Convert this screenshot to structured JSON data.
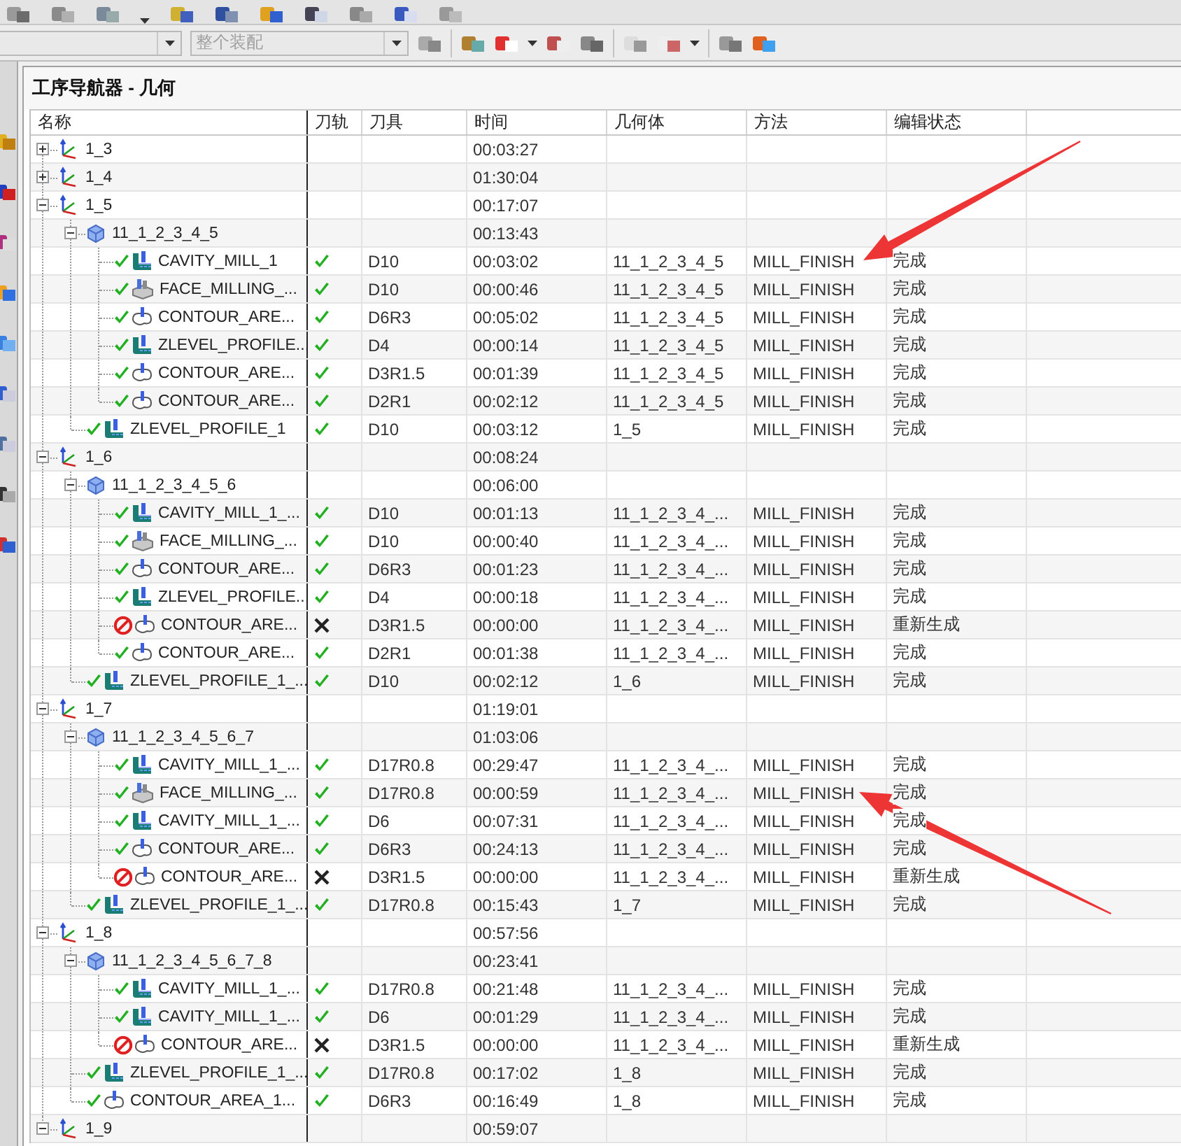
{
  "type_filter": {
    "value": "整个装配",
    "disabled": true
  },
  "navigator": {
    "title": "工序导航器 - 几何",
    "columns": [
      "名称",
      "刀轨",
      "刀具",
      "时间",
      "几何体",
      "方法",
      "编辑状态"
    ],
    "rows": [
      {
        "kind": "mcs",
        "name": "1_3",
        "expanded": false,
        "time": "00:03:27"
      },
      {
        "kind": "mcs",
        "name": "1_4",
        "expanded": false,
        "time": "01:30:04"
      },
      {
        "kind": "mcs",
        "name": "1_5",
        "expanded": true,
        "time": "00:17:07",
        "children": [
          {
            "kind": "workpiece",
            "name": "11_1_2_3_4_5",
            "expanded": true,
            "time": "00:13:43",
            "children": [
              {
                "kind": "cavity",
                "name": "CAVITY_MILL_1",
                "generated": true,
                "tool": "D10",
                "time": "00:03:02",
                "geometry": "11_1_2_3_4_5",
                "method": "MILL_FINISH",
                "edit_status": "完成",
                "arrow_from_above": true
              },
              {
                "kind": "face",
                "name": "FACE_MILLING_...",
                "generated": true,
                "tool": "D10",
                "time": "00:00:46",
                "geometry": "11_1_2_3_4_5",
                "method": "MILL_FINISH",
                "edit_status": "完成"
              },
              {
                "kind": "contour",
                "name": "CONTOUR_ARE...",
                "generated": true,
                "tool": "D6R3",
                "time": "00:05:02",
                "geometry": "11_1_2_3_4_5",
                "method": "MILL_FINISH",
                "edit_status": "完成"
              },
              {
                "kind": "zlevel",
                "name": "ZLEVEL_PROFILE...",
                "generated": true,
                "tool": "D4",
                "time": "00:00:14",
                "geometry": "11_1_2_3_4_5",
                "method": "MILL_FINISH",
                "edit_status": "完成"
              },
              {
                "kind": "contour",
                "name": "CONTOUR_ARE...",
                "generated": true,
                "tool": "D3R1.5",
                "time": "00:01:39",
                "geometry": "11_1_2_3_4_5",
                "method": "MILL_FINISH",
                "edit_status": "完成"
              },
              {
                "kind": "contour",
                "name": "CONTOUR_ARE...",
                "generated": true,
                "tool": "D2R1",
                "time": "00:02:12",
                "geometry": "11_1_2_3_4_5",
                "method": "MILL_FINISH",
                "edit_status": "完成"
              }
            ]
          },
          {
            "kind": "zlevel",
            "name": "ZLEVEL_PROFILE_1",
            "generated": true,
            "tool": "D10",
            "time": "00:03:12",
            "geometry": "1_5",
            "method": "MILL_FINISH",
            "edit_status": "完成"
          }
        ]
      },
      {
        "kind": "mcs",
        "name": "1_6",
        "expanded": true,
        "time": "00:08:24",
        "children": [
          {
            "kind": "workpiece",
            "name": "11_1_2_3_4_5_6",
            "expanded": true,
            "time": "00:06:00",
            "children": [
              {
                "kind": "cavity",
                "name": "CAVITY_MILL_1_...",
                "generated": true,
                "tool": "D10",
                "time": "00:01:13",
                "geometry": "11_1_2_3_4_...",
                "method": "MILL_FINISH",
                "edit_status": "完成"
              },
              {
                "kind": "face",
                "name": "FACE_MILLING_...",
                "generated": true,
                "tool": "D10",
                "time": "00:00:40",
                "geometry": "11_1_2_3_4_...",
                "method": "MILL_FINISH",
                "edit_status": "完成"
              },
              {
                "kind": "contour",
                "name": "CONTOUR_ARE...",
                "generated": true,
                "tool": "D6R3",
                "time": "00:01:23",
                "geometry": "11_1_2_3_4_...",
                "method": "MILL_FINISH",
                "edit_status": "完成"
              },
              {
                "kind": "zlevel",
                "name": "ZLEVEL_PROFILE...",
                "generated": true,
                "tool": "D4",
                "time": "00:00:18",
                "geometry": "11_1_2_3_4_...",
                "method": "MILL_FINISH",
                "edit_status": "完成"
              },
              {
                "kind": "contour",
                "name": "CONTOUR_ARE...",
                "generated": false,
                "tool": "D3R1.5",
                "time": "00:00:00",
                "geometry": "11_1_2_3_4_...",
                "method": "MILL_FINISH",
                "edit_status": "重新生成"
              },
              {
                "kind": "contour",
                "name": "CONTOUR_ARE...",
                "generated": true,
                "tool": "D2R1",
                "time": "00:01:38",
                "geometry": "11_1_2_3_4_...",
                "method": "MILL_FINISH",
                "edit_status": "完成"
              }
            ]
          },
          {
            "kind": "zlevel",
            "name": "ZLEVEL_PROFILE_1_...",
            "generated": true,
            "tool": "D10",
            "time": "00:02:12",
            "geometry": "1_6",
            "method": "MILL_FINISH",
            "edit_status": "完成"
          }
        ]
      },
      {
        "kind": "mcs",
        "name": "1_7",
        "expanded": true,
        "time": "01:19:01",
        "children": [
          {
            "kind": "workpiece",
            "name": "11_1_2_3_4_5_6_7",
            "expanded": true,
            "time": "01:03:06",
            "children": [
              {
                "kind": "cavity",
                "name": "CAVITY_MILL_1_...",
                "generated": true,
                "tool": "D17R0.8",
                "time": "00:29:47",
                "geometry": "11_1_2_3_4_...",
                "method": "MILL_FINISH",
                "edit_status": "完成"
              },
              {
                "kind": "face",
                "name": "FACE_MILLING_...",
                "generated": true,
                "tool": "D17R0.8",
                "time": "00:00:59",
                "geometry": "11_1_2_3_4_...",
                "method": "MILL_FINISH",
                "edit_status": "完成",
                "arrow_from_above": false
              },
              {
                "kind": "cavity",
                "name": "CAVITY_MILL_1_...",
                "generated": true,
                "tool": "D6",
                "time": "00:07:31",
                "geometry": "11_1_2_3_4_...",
                "method": "MILL_FINISH",
                "edit_status": "完成"
              },
              {
                "kind": "contour",
                "name": "CONTOUR_ARE...",
                "generated": true,
                "tool": "D6R3",
                "time": "00:24:13",
                "geometry": "11_1_2_3_4_...",
                "method": "MILL_FINISH",
                "edit_status": "完成"
              },
              {
                "kind": "contour",
                "name": "CONTOUR_ARE...",
                "generated": false,
                "tool": "D3R1.5",
                "time": "00:00:00",
                "geometry": "11_1_2_3_4_...",
                "method": "MILL_FINISH",
                "edit_status": "重新生成"
              }
            ]
          },
          {
            "kind": "zlevel",
            "name": "ZLEVEL_PROFILE_1_...",
            "generated": true,
            "tool": "D17R0.8",
            "time": "00:15:43",
            "geometry": "1_7",
            "method": "MILL_FINISH",
            "edit_status": "完成"
          }
        ]
      },
      {
        "kind": "mcs",
        "name": "1_8",
        "expanded": true,
        "time": "00:57:56",
        "children": [
          {
            "kind": "workpiece",
            "name": "11_1_2_3_4_5_6_7_8",
            "expanded": true,
            "time": "00:23:41",
            "children": [
              {
                "kind": "cavity",
                "name": "CAVITY_MILL_1_...",
                "generated": true,
                "tool": "D17R0.8",
                "time": "00:21:48",
                "geometry": "11_1_2_3_4_...",
                "method": "MILL_FINISH",
                "edit_status": "完成"
              },
              {
                "kind": "cavity",
                "name": "CAVITY_MILL_1_...",
                "generated": true,
                "tool": "D6",
                "time": "00:01:29",
                "geometry": "11_1_2_3_4_...",
                "method": "MILL_FINISH",
                "edit_status": "完成"
              },
              {
                "kind": "contour",
                "name": "CONTOUR_ARE...",
                "generated": false,
                "tool": "D3R1.5",
                "time": "00:00:00",
                "geometry": "11_1_2_3_4_...",
                "method": "MILL_FINISH",
                "edit_status": "重新生成"
              }
            ]
          },
          {
            "kind": "zlevel",
            "name": "ZLEVEL_PROFILE_1_...",
            "generated": true,
            "tool": "D17R0.8",
            "time": "00:17:02",
            "geometry": "1_8",
            "method": "MILL_FINISH",
            "edit_status": "完成"
          },
          {
            "kind": "contour",
            "name": "CONTOUR_AREA_1...",
            "generated": true,
            "tool": "D6R3",
            "time": "00:16:49",
            "geometry": "1_8",
            "method": "MILL_FINISH",
            "edit_status": "完成"
          }
        ]
      },
      {
        "kind": "mcs",
        "name": "1_9",
        "expanded": true,
        "time": "00:59:07"
      }
    ]
  }
}
